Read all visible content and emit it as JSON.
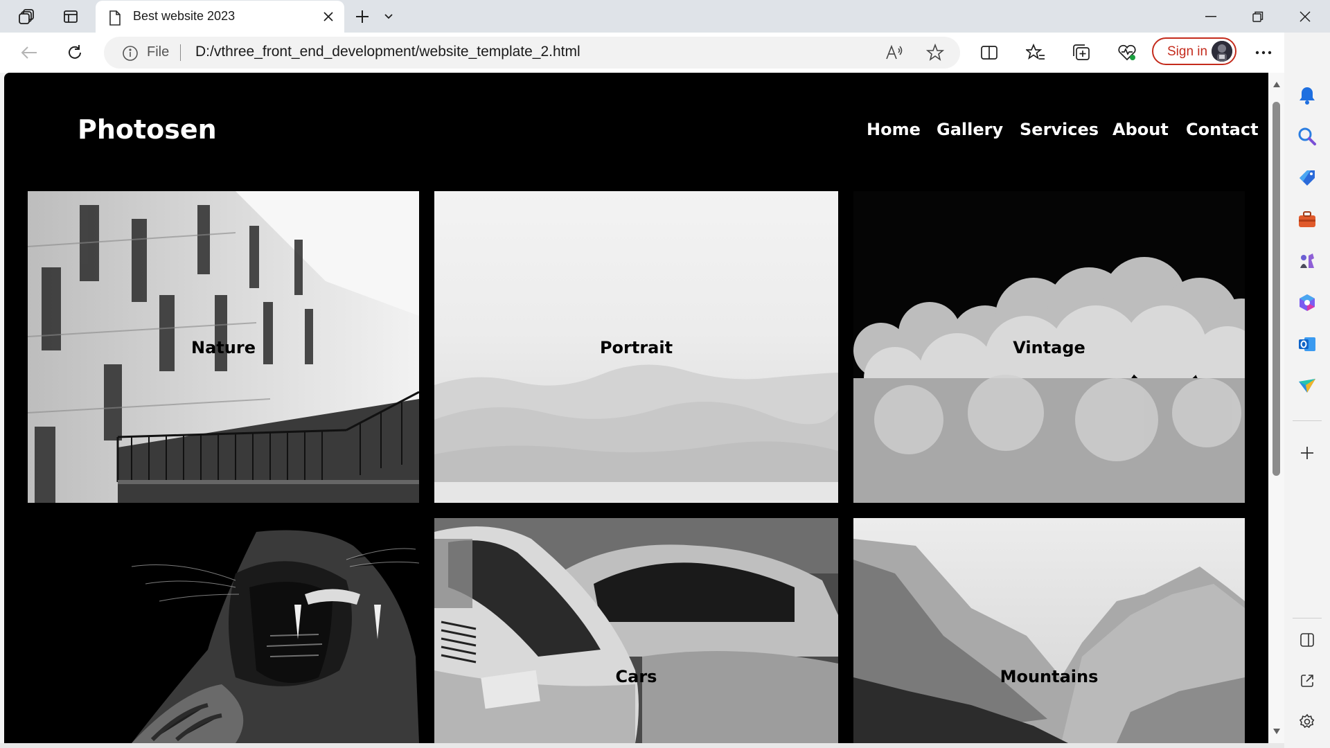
{
  "browser": {
    "tab_title": "Best website 2023",
    "address_scheme": "File",
    "address_url": "D:/vthree_front_end_development/website_template_2.html",
    "sign_in_label": "Sign in"
  },
  "site": {
    "logo": "Photosen",
    "nav": [
      "Home",
      "Gallery",
      "Services",
      "About",
      "Contact"
    ],
    "cards": [
      {
        "label": "Nature",
        "image": "building-facade-photo"
      },
      {
        "label": "Portrait",
        "image": "misty-landscape-photo"
      },
      {
        "label": "Vintage",
        "image": "clouds-photo"
      },
      {
        "label": "",
        "image": "tiger-roar-photo"
      },
      {
        "label": "Cars",
        "image": "vintage-cars-photo"
      },
      {
        "label": "Mountains",
        "image": "mountains-photo"
      }
    ]
  },
  "colors": {
    "page_background": "#000000",
    "sign_in_accent": "#c42b1c"
  }
}
